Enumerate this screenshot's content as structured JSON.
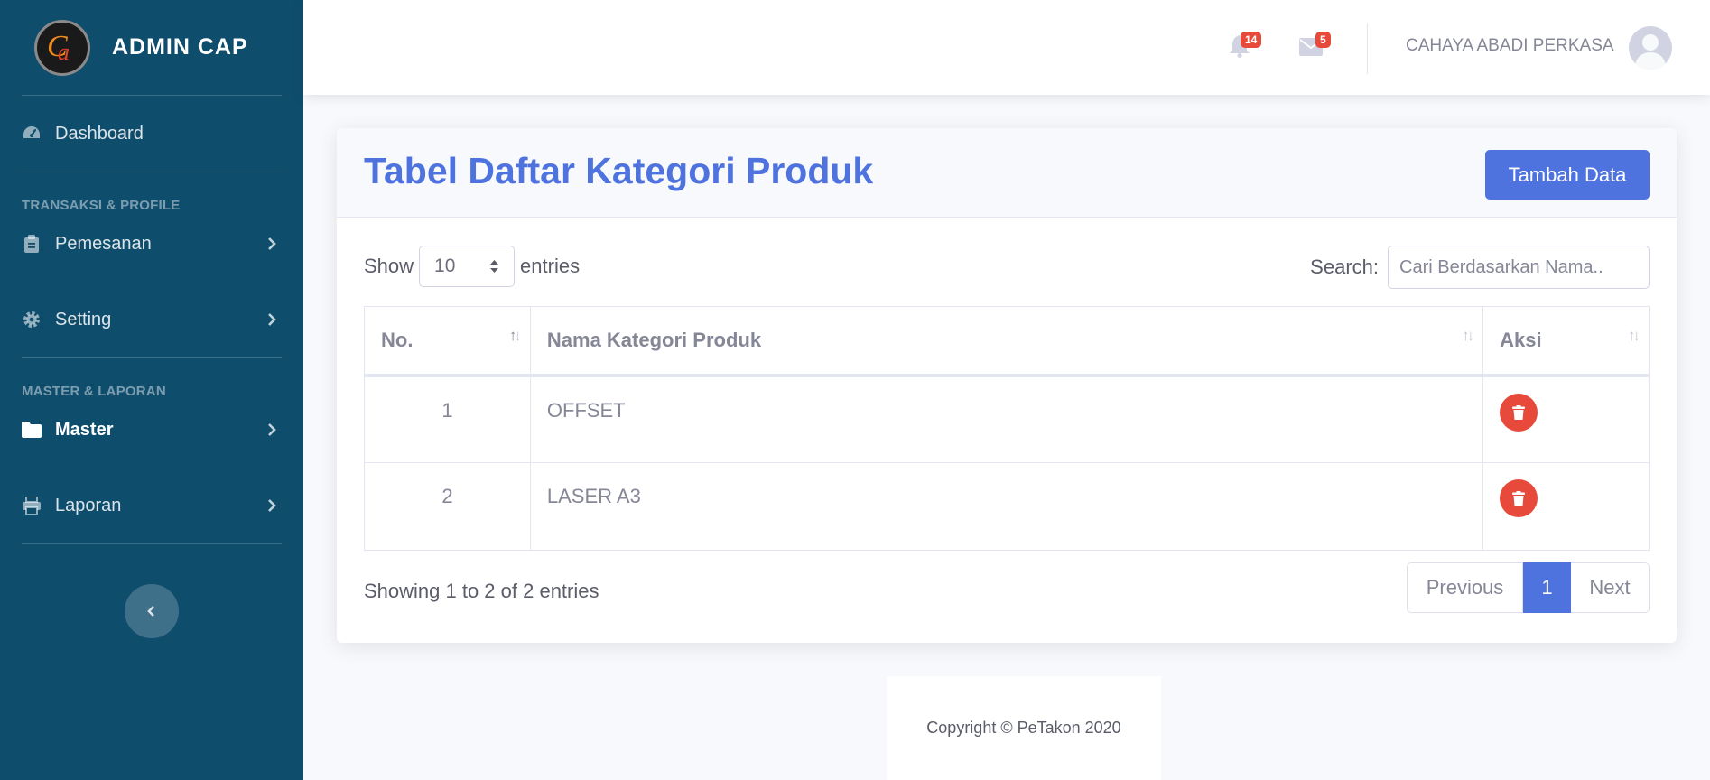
{
  "brand": {
    "name": "ADMIN CAP",
    "logo_letters": "Ca"
  },
  "sidebar": {
    "items_top": [
      {
        "label": "Dashboard",
        "icon": "tachometer-icon"
      }
    ],
    "heading1": "TRANSAKSI & PROFILE",
    "group1": [
      {
        "label": "Pemesanan",
        "icon": "clipboard-icon"
      },
      {
        "label": "Setting",
        "icon": "gear-icon"
      }
    ],
    "heading2": "MASTER & LAPORAN",
    "group2": [
      {
        "label": "Master",
        "icon": "folder-icon",
        "active": true
      },
      {
        "label": "Laporan",
        "icon": "printer-icon"
      }
    ]
  },
  "topbar": {
    "alerts_count": "14",
    "messages_count": "5",
    "user_name": "CAHAYA ABADI PERKASA"
  },
  "card": {
    "title": "Tabel Daftar Kategori Produk",
    "add_button": "Tambah Data"
  },
  "table_controls": {
    "show_label": "Show",
    "entries_value": "10",
    "entries_label": "entries",
    "search_label": "Search:",
    "search_placeholder": "Cari Berdasarkan Nama.."
  },
  "table": {
    "columns": [
      "No.",
      "Nama Kategori Produk",
      "Aksi"
    ],
    "rows": [
      {
        "no": "1",
        "name": "OFFSET"
      },
      {
        "no": "2",
        "name": "LASER A3"
      }
    ]
  },
  "pagination": {
    "info": "Showing 1 to 2 of 2 entries",
    "previous": "Previous",
    "current": "1",
    "next": "Next"
  },
  "footer": {
    "text": "Copyright © PeTakon 2020"
  },
  "colors": {
    "sidebar_bg": "#0f4d6d",
    "primary": "#4e73df",
    "danger": "#e74a3b"
  }
}
